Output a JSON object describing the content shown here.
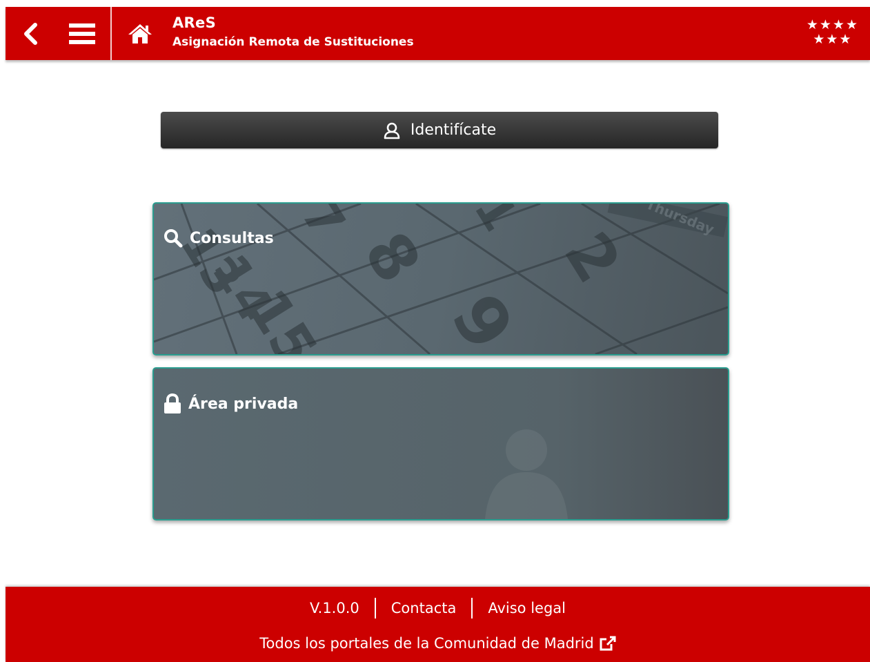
{
  "header": {
    "title": "AReS",
    "subtitle": "Asignación Remota de Sustituciones",
    "stars_top": "★★★★",
    "stars_bottom": "★★★",
    "color": "#cc0000"
  },
  "login": {
    "label": "Identifícate"
  },
  "cards": [
    {
      "label": "Consultas",
      "icon": "search-icon"
    },
    {
      "label": "Área privada",
      "icon": "lock-icon"
    }
  ],
  "calendar_numbers": [
    "13",
    "14",
    "15",
    "7",
    "8",
    "9",
    "1",
    "2",
    "Thursday"
  ],
  "footer": {
    "version": "V.1.0.0",
    "contact": "Contacta",
    "legal": "Aviso legal",
    "portals": "Todos los portales de la Comunidad de Madrid"
  },
  "colors": {
    "brand_red": "#cc0000",
    "accent_teal": "#2a9d8f",
    "button_dark": "#333333"
  }
}
